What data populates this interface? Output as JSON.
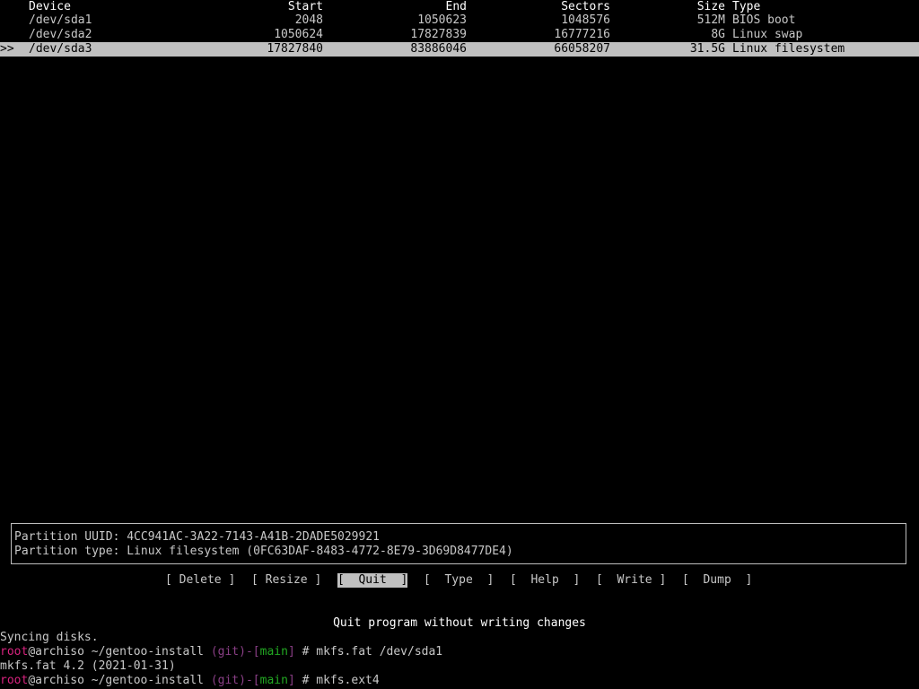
{
  "table": {
    "headers": {
      "device": "Device",
      "start": "Start",
      "end": "End",
      "sectors": "Sectors",
      "size": "Size",
      "type": "Type"
    },
    "rows": [
      {
        "marker": "",
        "device": "/dev/sda1",
        "start": "2048",
        "end": "1050623",
        "sectors": "1048576",
        "size": "512M",
        "type": "BIOS boot",
        "selected": false
      },
      {
        "marker": "",
        "device": "/dev/sda2",
        "start": "1050624",
        "end": "17827839",
        "sectors": "16777216",
        "size": "8G",
        "type": "Linux swap",
        "selected": false
      },
      {
        "marker": ">>",
        "device": "/dev/sda3",
        "start": "17827840",
        "end": "83886046",
        "sectors": "66058207",
        "size": "31.5G",
        "type": "Linux filesystem",
        "selected": true
      }
    ]
  },
  "info": {
    "uuid_line": "Partition UUID: 4CC941AC-3A22-7143-A41B-2DADE5029921",
    "type_line": "Partition type: Linux filesystem (0FC63DAF-8483-4772-8E79-3D69D8477DE4)"
  },
  "menu": [
    {
      "label": "[ Delete ]",
      "active": false
    },
    {
      "label": "[ Resize ]",
      "active": false
    },
    {
      "label": "[  Quit  ]",
      "active": true
    },
    {
      "label": "[  Type  ]",
      "active": false
    },
    {
      "label": "[  Help  ]",
      "active": false
    },
    {
      "label": "[  Write ]",
      "active": false
    },
    {
      "label": "[  Dump  ]",
      "active": false
    }
  ],
  "hint": "Quit program without writing changes",
  "terminal": {
    "syncing": "Syncing disks.",
    "prompt_user": "root",
    "prompt_host": "@archiso",
    "prompt_path": " ~/gentoo-install ",
    "prompt_git_open": "(",
    "prompt_git": "git",
    "prompt_git_close": ")-[",
    "prompt_branch": "main",
    "prompt_branch_close": "]",
    "prompt_hash": " # ",
    "cmd1": "mkfs.fat /dev/sda1",
    "output1": "mkfs.fat 4.2 (2021-01-31)",
    "cmd2": "mkfs.ext4"
  },
  "colors": {
    "background": "#000000",
    "text": "#c8c8c8",
    "highlight": "#c0c0c0",
    "prompt_root": "#d8237f",
    "prompt_git": "#8a3f86",
    "prompt_branch": "#22a822"
  }
}
